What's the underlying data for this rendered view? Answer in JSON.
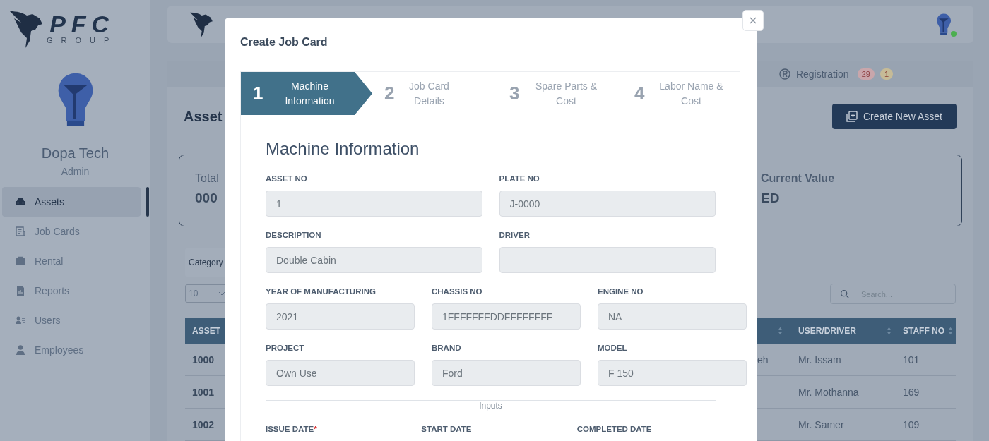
{
  "sidebar": {
    "logo": {
      "name": "PFC",
      "tagline": "GROUP"
    },
    "profile": {
      "name": "Dopa Tech",
      "role": "Admin"
    },
    "items": [
      {
        "label": "Assets",
        "selected": true
      },
      {
        "label": "Job Cards",
        "selected": false
      },
      {
        "label": "Rental",
        "selected": false
      },
      {
        "label": "Reports",
        "selected": false
      },
      {
        "label": "Users",
        "selected": false
      },
      {
        "label": "Employees",
        "selected": false
      }
    ]
  },
  "header": {
    "online": true
  },
  "page": {
    "tabs": [
      {
        "label": "Registration",
        "selected": false,
        "badges": [
          {
            "text": "29",
            "color": "#c9a6ab"
          },
          {
            "text": "1",
            "color": "#c6bb97"
          }
        ]
      }
    ],
    "title": "Asset",
    "create_button": "Create New Asset",
    "stats": [
      {
        "label": "Total",
        "value": "000"
      },
      {
        "label": "Current Value",
        "value": "ED"
      }
    ],
    "category_filter": "Category",
    "page_size": "10",
    "search": {
      "placeholder": "Search..."
    },
    "table": {
      "columns": [
        {
          "label": "ASSET"
        },
        {
          "label": "USER/DRIVER"
        },
        {
          "label": "STAFF NO"
        }
      ],
      "rows": [
        {
          "asset_no": "1000",
          "column_2": "eh",
          "user_driver": "Mr. Issam",
          "staff_no": "101"
        },
        {
          "asset_no": "1001",
          "user_driver": "Mr. Mothanna",
          "staff_no": "169"
        },
        {
          "asset_no": "1002",
          "user_driver": "Mr. Samer",
          "staff_no": "109"
        }
      ]
    }
  },
  "modal": {
    "title": "Create Job Card",
    "steps": [
      {
        "number": "1",
        "label": "Machine Information",
        "selected": true
      },
      {
        "number": "2",
        "label": "Job Card Details",
        "selected": false
      },
      {
        "number": "3",
        "label": "Spare Parts & Cost",
        "selected": false
      },
      {
        "number": "4",
        "label": "Labor Name & Cost",
        "selected": false
      }
    ],
    "section_title": "Machine Information",
    "rows": [
      [
        {
          "label": "ASSET NO",
          "value": "1"
        },
        {
          "label": "PLATE NO",
          "value": "J-0000"
        }
      ],
      [
        {
          "label": "DESCRIPTION",
          "value": "Double Cabin"
        },
        {
          "label": "DRIVER"
        }
      ],
      [
        {
          "label": "YEAR OF MANUFACTURING",
          "value": "2021"
        },
        {
          "label": "CHASSIS NO",
          "value": "1FFFFFFFDDFFFFFFFF"
        },
        {
          "label": "ENGINE NO",
          "value": "NA"
        }
      ],
      [
        {
          "label": "PROJECT",
          "value": "Own Use"
        },
        {
          "label": "BRAND",
          "value": "Ford"
        },
        {
          "label": "MODEL",
          "value": "F 150"
        }
      ]
    ],
    "divider_label": "Inputs",
    "date_fields": [
      {
        "label": "ISSUE DATE",
        "required_mark": "*"
      },
      {
        "label": "START DATE"
      },
      {
        "label": "COMPLETED DATE"
      }
    ]
  }
}
